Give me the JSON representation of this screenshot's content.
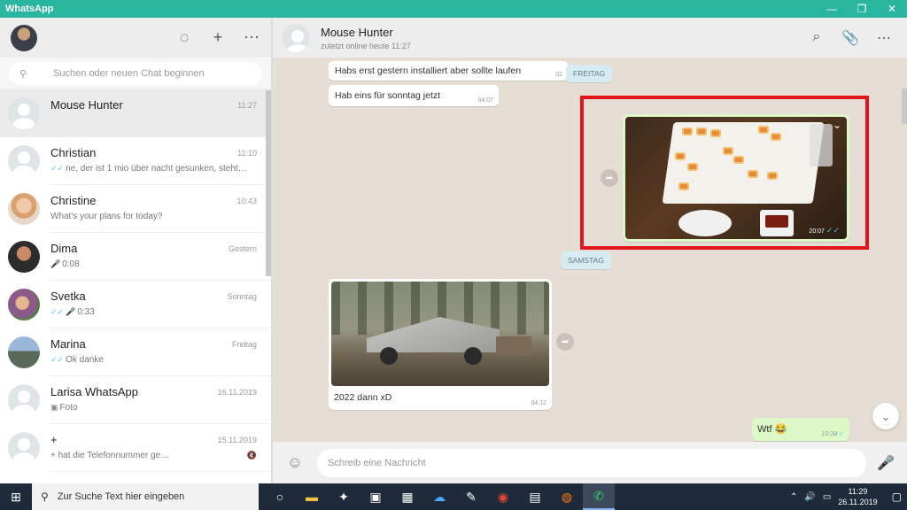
{
  "window": {
    "title": "WhatsApp",
    "minimize": "—",
    "restore": "❐",
    "close": "✕"
  },
  "sidebar": {
    "icons": {
      "status": "◌",
      "new_chat": "+",
      "menu": "⋯"
    },
    "search_placeholder": "Suchen oder neuen Chat beginnen",
    "chats": [
      {
        "name": "Mouse Hunter",
        "time": "11:27",
        "preview": "",
        "tick": "",
        "mic": ""
      },
      {
        "name": "Christian",
        "time": "11:10",
        "preview": "ne, der ist 1 mio über nacht gesunken, steht…",
        "tick": "✓✓",
        "mic": ""
      },
      {
        "name": "Christine",
        "time": "10:43",
        "preview": "What's your plans for today?",
        "tick": "",
        "mic": ""
      },
      {
        "name": "Dima",
        "time": "Gestern",
        "preview": "0:08",
        "tick": "",
        "mic": "🎤"
      },
      {
        "name": "Svetka",
        "time": "Sonntag",
        "preview": "0:33",
        "tick": "✓✓",
        "mic": "🎤"
      },
      {
        "name": "Marina",
        "time": "Freitag",
        "preview": "Ok danke",
        "tick": "✓✓",
        "mic": ""
      },
      {
        "name": "Larisa WhatsApp",
        "time": "16.11.2019",
        "preview": "Foto",
        "tick": "",
        "mic": ""
      },
      {
        "name": "+",
        "time": "15.11.2019",
        "preview": "+                            hat die Telefonnummer ge…",
        "tick": "",
        "mic": ""
      }
    ]
  },
  "conversation": {
    "contact_name": "Mouse Hunter",
    "contact_status": "zuletzt online heute 11:27",
    "icons": {
      "search": "⌕",
      "attach": "📎",
      "menu": "⋯"
    },
    "messages": [
      {
        "text": "Habs erst gestern installiert aber sollte laufen",
        "time": "02"
      },
      {
        "text": "Hab eins für sonntag jetzt",
        "time": "04:07"
      }
    ],
    "date_chips": {
      "friday": "FREITAG",
      "saturday": "SAMSTAG"
    },
    "image_message": {
      "time": "20:07",
      "tick": "✓✓"
    },
    "truck_message": {
      "caption": "2022 dann xD",
      "time": "04:12"
    },
    "wtf_message": {
      "text": "Wtf 😂",
      "time": "10:20",
      "tick": "✓✓"
    },
    "composer_placeholder": "Schreib eine Nachricht"
  },
  "taskbar": {
    "search_placeholder": "Zur Suche Text hier eingeben",
    "time": "11:29",
    "date": "26.11.2019"
  }
}
